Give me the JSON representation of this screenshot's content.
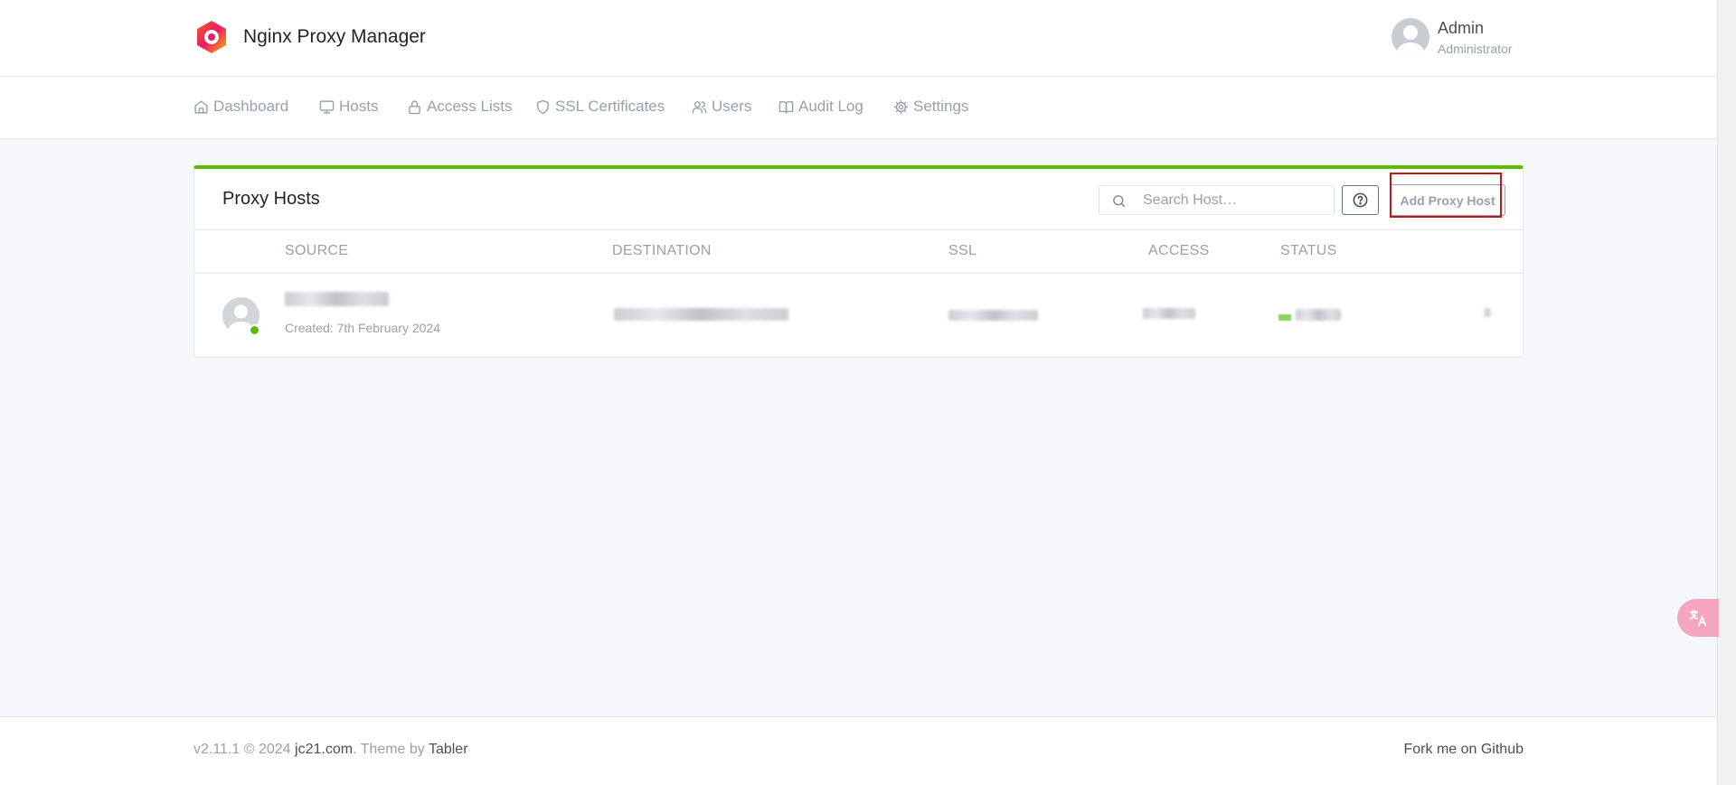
{
  "brand": {
    "name": "Nginx Proxy Manager",
    "logo_icon": "npm-hexagon-logo"
  },
  "user": {
    "name": "Admin",
    "role": "Administrator"
  },
  "nav": [
    {
      "label": "Dashboard",
      "icon": "home-icon"
    },
    {
      "label": "Hosts",
      "icon": "monitor-icon"
    },
    {
      "label": "Access Lists",
      "icon": "lock-icon"
    },
    {
      "label": "SSL Certificates",
      "icon": "shield-icon"
    },
    {
      "label": "Users",
      "icon": "users-icon"
    },
    {
      "label": "Audit Log",
      "icon": "book-icon"
    },
    {
      "label": "Settings",
      "icon": "gear-icon"
    }
  ],
  "card": {
    "title": "Proxy Hosts",
    "search_placeholder": "Search Host…",
    "add_button": "Add Proxy Host",
    "columns": [
      "SOURCE",
      "DESTINATION",
      "SSL",
      "ACCESS",
      "STATUS"
    ],
    "rows": [
      {
        "created": "Created: 7th February 2024",
        "online": true
      }
    ]
  },
  "footer": {
    "version": "v2.11.1 © 2024 ",
    "company": "jc21.com",
    "theme_by": ". Theme by ",
    "theme_name": "Tabler",
    "github": "Fork me on Github"
  },
  "colors": {
    "accent": "#5eba00",
    "highlight": "#c0161d",
    "translate": "#f4a6c0"
  }
}
